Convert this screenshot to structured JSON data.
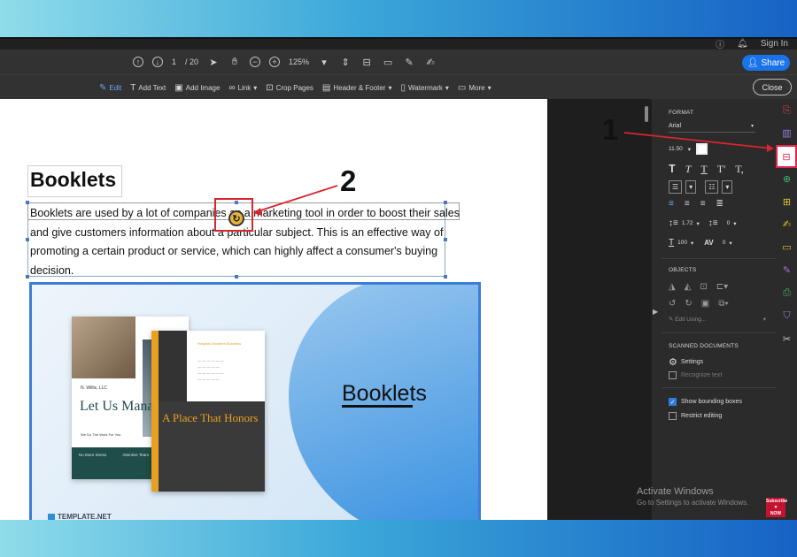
{
  "topbar": {
    "help_icon": "help-icon",
    "bell_icon": "bell-icon",
    "sign_in": "Sign In"
  },
  "toolbar": {
    "page_current": "1",
    "page_total": "/ 20",
    "zoom": "125%",
    "share_label": "Share"
  },
  "edit_toolbar": {
    "items": [
      "Edit",
      "Add Text",
      "Add Image",
      "Link",
      "Crop Pages",
      "Header & Footer",
      "Watermark",
      "More"
    ],
    "close_label": "Close"
  },
  "document": {
    "heading": "Booklets",
    "paragraph": "Booklets are used by a lot of companies as a marketing tool in order to boost their sales and give customers information about a particular subject. This is an effective way of promoting a certain product or service, which can highly affect a consumer's buying decision.",
    "image": {
      "title": "Booklets",
      "brand": "TEMPLATE.NET",
      "book1_company": "N. Willis, LLC",
      "book1_title": "Let Us Manage",
      "book1_tagline": "We Do The Work For You",
      "book1_footer_left": "No More Stress",
      "book1_footer_right": "Attentive Team",
      "book2_title": "A Place That Honors",
      "book2_header": "Hospital Excellent Business"
    }
  },
  "format_panel": {
    "format_heading": "FORMAT",
    "font_name": "Arial",
    "font_size": "11.50",
    "line_spacing": "1.72",
    "para_spacing": "0",
    "horizontal_scale": "100",
    "char_spacing": "0",
    "objects_heading": "OBJECTS",
    "edit_using": "Edit Using...",
    "scanned_heading": "SCANNED DOCUMENTS",
    "settings_label": "Settings",
    "recognize_text": "Recognize text",
    "show_bounding_boxes": "Show bounding boxes",
    "restrict_editing": "Restrict editing"
  },
  "annotations": {
    "label_1": "1",
    "label_2": "2",
    "accent": "#d8262e"
  },
  "overlay": {
    "activate_title": "Activate Windows",
    "activate_sub": "Go to Settings to activate Windows.",
    "subscribe_line1": "Subscribe",
    "subscribe_line2": "NOW"
  }
}
